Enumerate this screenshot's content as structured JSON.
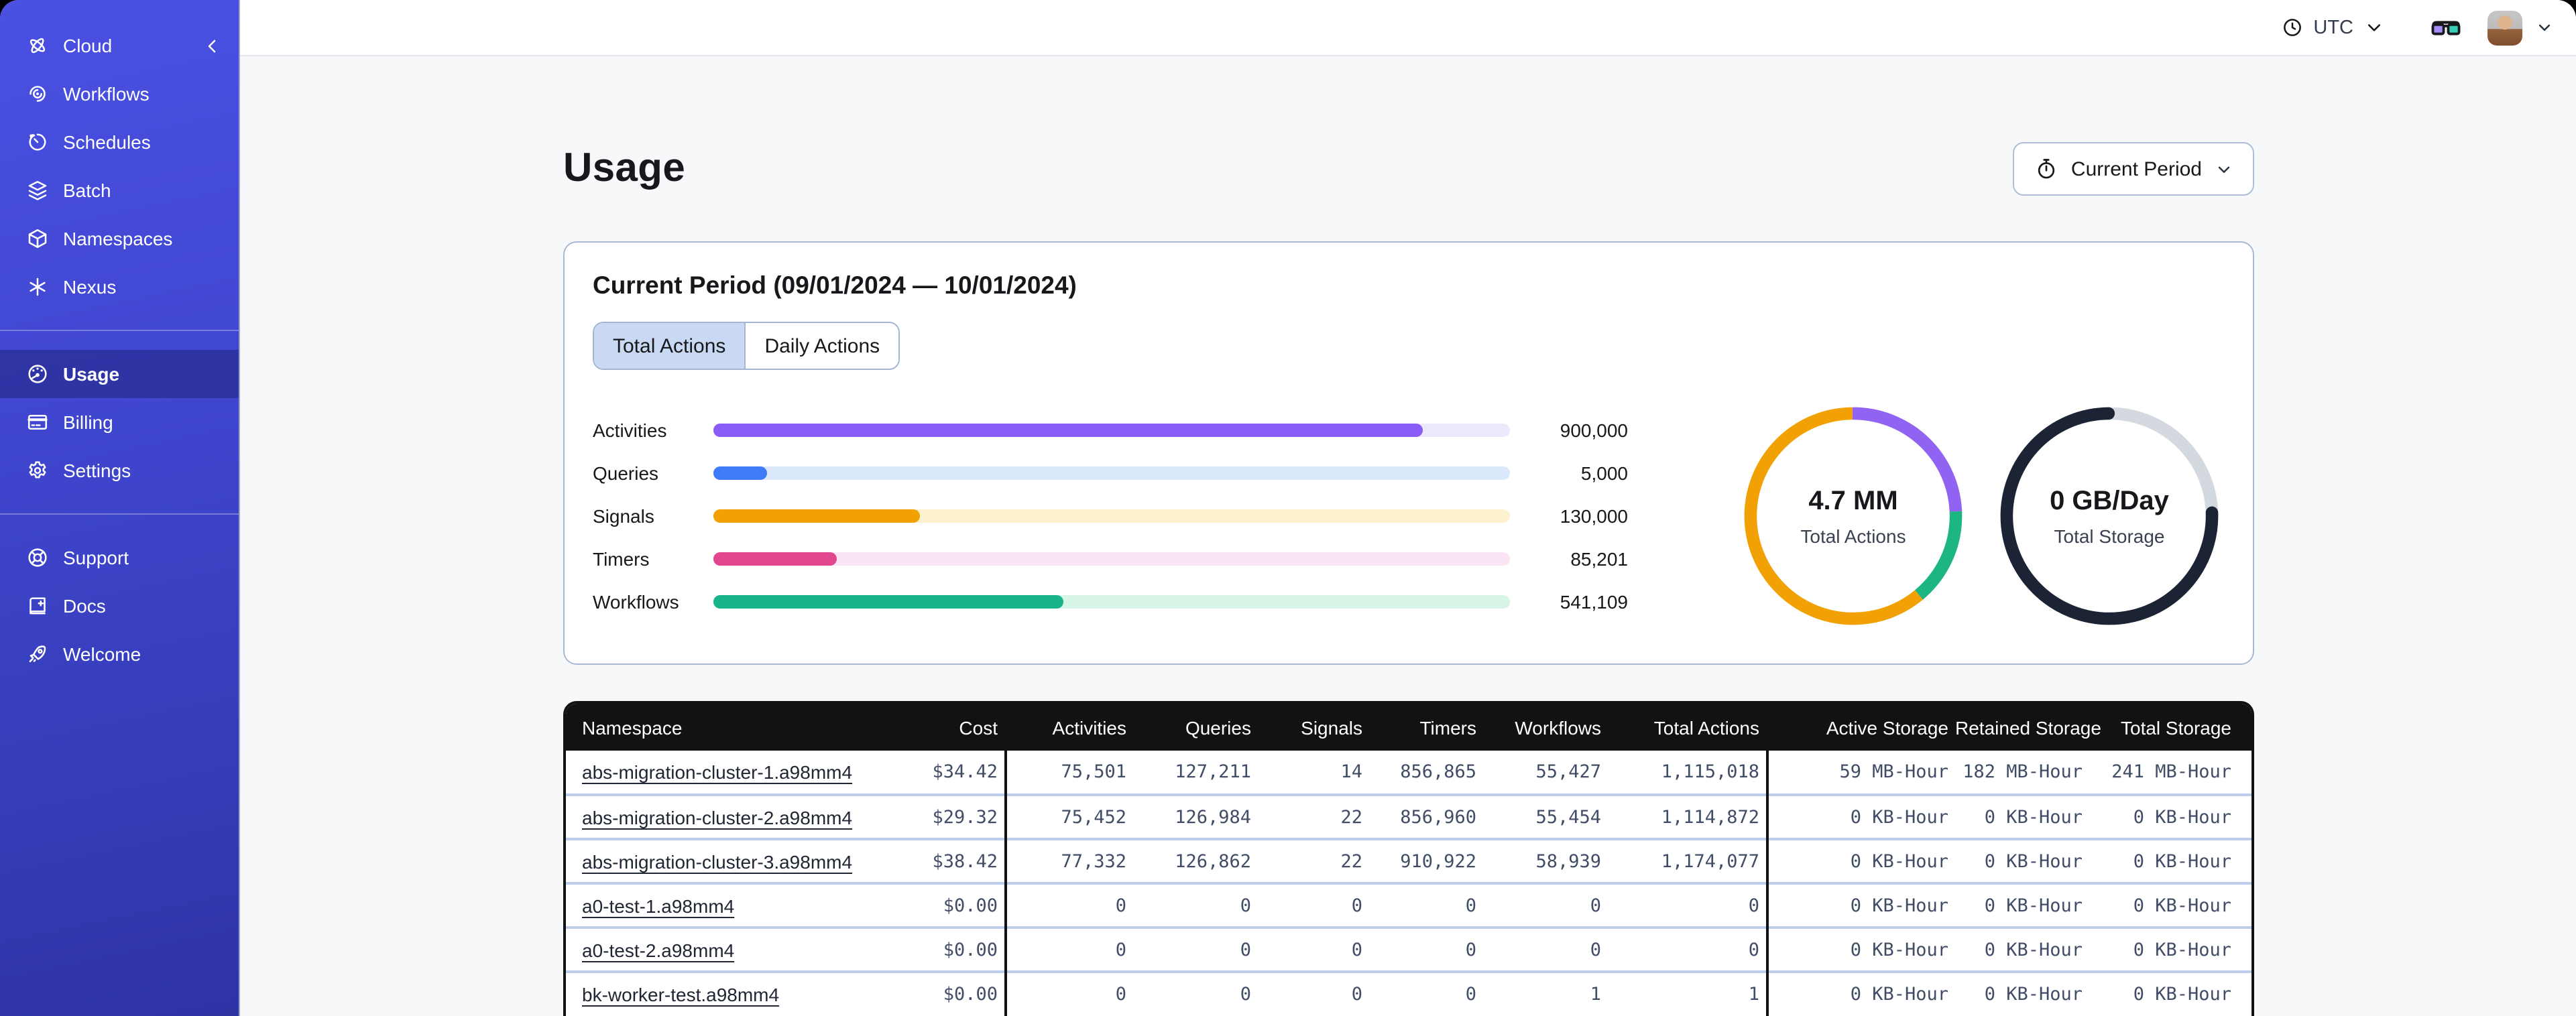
{
  "sidebar": {
    "brand": {
      "label": "Cloud"
    },
    "groups": [
      {
        "items": [
          {
            "label": "Workflows",
            "icon": "workflows-icon"
          },
          {
            "label": "Schedules",
            "icon": "schedules-icon"
          },
          {
            "label": "Batch",
            "icon": "batch-icon"
          },
          {
            "label": "Namespaces",
            "icon": "namespaces-icon"
          },
          {
            "label": "Nexus",
            "icon": "nexus-icon"
          }
        ]
      },
      {
        "items": [
          {
            "label": "Usage",
            "icon": "usage-icon",
            "active": true
          },
          {
            "label": "Billing",
            "icon": "billing-icon"
          },
          {
            "label": "Settings",
            "icon": "settings-icon"
          }
        ]
      },
      {
        "items": [
          {
            "label": "Support",
            "icon": "support-icon"
          },
          {
            "label": "Docs",
            "icon": "docs-icon"
          },
          {
            "label": "Welcome",
            "icon": "welcome-icon"
          }
        ]
      }
    ]
  },
  "topbar": {
    "timezone": "UTC"
  },
  "page": {
    "title": "Usage",
    "period_button": "Current Period"
  },
  "card": {
    "title": "Current Period (09/01/2024 — 10/01/2024)",
    "tabs": [
      {
        "label": "Total Actions",
        "active": true
      },
      {
        "label": "Daily Actions",
        "active": false
      }
    ]
  },
  "chart_data": [
    {
      "type": "bar",
      "orientation": "horizontal",
      "categories": [
        "Activities",
        "Queries",
        "Signals",
        "Timers",
        "Workflows"
      ],
      "values": [
        900000,
        5000,
        130000,
        85201,
        541109
      ],
      "value_labels": [
        "900,000",
        "5,000",
        "130,000",
        "85,201",
        "541,109"
      ],
      "fill_fractions": [
        0.89,
        0.067,
        0.26,
        0.155,
        0.44
      ],
      "colors": [
        "#8A5CF6",
        "#3E7BF6",
        "#F2A104",
        "#E2468E",
        "#16B487"
      ],
      "track_colors": [
        "#EDE8FC",
        "#DBE8FC",
        "#FCF2CE",
        "#FBE4F3",
        "#D6F5E7"
      ]
    },
    {
      "type": "donut",
      "center_value": "4.7 MM",
      "center_label": "Total Actions",
      "segments": [
        {
          "name": "activities",
          "color": "#9163F2",
          "fraction": 0.243
        },
        {
          "name": "workflows",
          "color": "#1DB584",
          "fraction": 0.147
        },
        {
          "name": "other",
          "color": "#F2A104",
          "fraction": 0.61
        }
      ]
    },
    {
      "type": "donut",
      "center_value": "0 GB/Day",
      "center_label": "Total Storage",
      "segments": [
        {
          "name": "remaining",
          "color": "#D4D8DF",
          "fraction": 0.245
        },
        {
          "name": "used",
          "color": "#1B2334",
          "fraction": 0.755
        }
      ]
    }
  ],
  "table": {
    "columns": [
      "Namespace",
      "Cost",
      "Activities",
      "Queries",
      "Signals",
      "Timers",
      "Workflows",
      "Total Actions",
      "Active Storage",
      "Retained Storage",
      "Total Storage"
    ],
    "rows": [
      [
        "abs-migration-cluster-1.a98mm4",
        "$34.42",
        "75,501",
        "127,211",
        "14",
        "856,865",
        "55,427",
        "1,115,018",
        "59 MB-Hour",
        "182 MB-Hour",
        "241 MB-Hour"
      ],
      [
        "abs-migration-cluster-2.a98mm4",
        "$29.32",
        "75,452",
        "126,984",
        "22",
        "856,960",
        "55,454",
        "1,114,872",
        "0 KB-Hour",
        "0 KB-Hour",
        "0 KB-Hour"
      ],
      [
        "abs-migration-cluster-3.a98mm4",
        "$38.42",
        "77,332",
        "126,862",
        "22",
        "910,922",
        "58,939",
        "1,174,077",
        "0 KB-Hour",
        "0 KB-Hour",
        "0 KB-Hour"
      ],
      [
        "a0-test-1.a98mm4",
        "$0.00",
        "0",
        "0",
        "0",
        "0",
        "0",
        "0",
        "0 KB-Hour",
        "0 KB-Hour",
        "0 KB-Hour"
      ],
      [
        "a0-test-2.a98mm4",
        "$0.00",
        "0",
        "0",
        "0",
        "0",
        "0",
        "0",
        "0 KB-Hour",
        "0 KB-Hour",
        "0 KB-Hour"
      ],
      [
        "bk-worker-test.a98mm4",
        "$0.00",
        "0",
        "0",
        "0",
        "0",
        "1",
        "1",
        "0 KB-Hour",
        "0 KB-Hour",
        "0 KB-Hour"
      ]
    ]
  }
}
